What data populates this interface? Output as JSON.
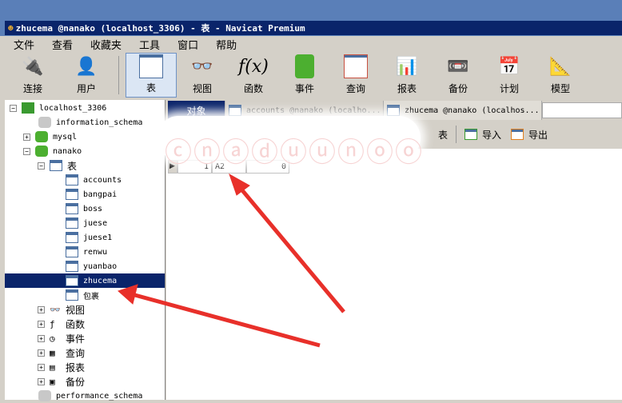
{
  "window": {
    "title": "zhucema @nanako (localhost_3306) - 表 - Navicat Premium"
  },
  "menu": [
    "文件",
    "查看",
    "收藏夹",
    "工具",
    "窗口",
    "帮助"
  ],
  "toolbar": [
    {
      "label": "连接",
      "icon": "plug-icon"
    },
    {
      "label": "用户",
      "icon": "user-icon"
    },
    {
      "label": "表",
      "icon": "table-icon",
      "active": true
    },
    {
      "label": "视图",
      "icon": "view-icon"
    },
    {
      "label": "函数",
      "icon": "function-icon"
    },
    {
      "label": "事件",
      "icon": "event-icon"
    },
    {
      "label": "查询",
      "icon": "query-icon"
    },
    {
      "label": "报表",
      "icon": "report-icon"
    },
    {
      "label": "备份",
      "icon": "backup-icon"
    },
    {
      "label": "计划",
      "icon": "schedule-icon"
    },
    {
      "label": "模型",
      "icon": "model-icon"
    }
  ],
  "tree": {
    "connection": "localhost_3306",
    "databases": [
      "information_schema",
      "mysql",
      "nanako"
    ],
    "tables_label": "表",
    "tables": [
      "accounts",
      "bangpai",
      "boss",
      "juese",
      "juese1",
      "renwu",
      "yuanbao",
      "zhucema",
      "包裹"
    ],
    "selected": "zhucema",
    "groups": [
      "视图",
      "函数",
      "事件",
      "查询",
      "报表",
      "备份"
    ],
    "last_db": "performance_schema"
  },
  "tabs": [
    "对象",
    "accounts @nanako (localho...",
    "zhucema @nanako (localhos..."
  ],
  "objbar": {
    "import": "导入",
    "export": "导出",
    "partial": "表"
  },
  "watermark": "unreadable text",
  "grid": {
    "row": [
      "1",
      "A2",
      "0"
    ]
  },
  "colors": {
    "titlebar": "#0a246a",
    "selection": "#0a246a",
    "arrow": "#e8302a"
  }
}
